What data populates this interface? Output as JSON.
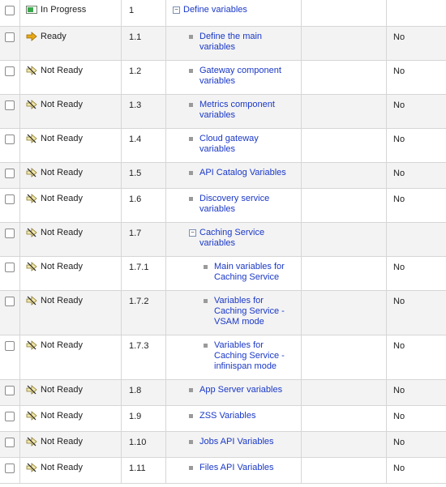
{
  "colors": {
    "link": "#1a38c7",
    "ready_arrow": "#e6a817",
    "progress_green": "#3aa84a",
    "grid": "#d6d6d6"
  },
  "rows": [
    {
      "state": "In Progress",
      "icon": "in-progress-icon",
      "number": "1",
      "title": "Define variables",
      "level": 0,
      "toggle": "−",
      "extra": "",
      "height": 32
    },
    {
      "state": "Ready",
      "icon": "ready-arrow-icon",
      "number": "1.1",
      "title": "Define the main variables",
      "level": 1,
      "extra": "No",
      "height": 42
    },
    {
      "state": "Not Ready",
      "icon": "not-ready-icon",
      "number": "1.2",
      "title": "Gateway component variables",
      "level": 1,
      "extra": "No",
      "height": 42
    },
    {
      "state": "Not Ready",
      "icon": "not-ready-icon",
      "number": "1.3",
      "title": "Metrics component variables",
      "level": 1,
      "extra": "No",
      "height": 42
    },
    {
      "state": "Not Ready",
      "icon": "not-ready-icon",
      "number": "1.4",
      "title": "Cloud gateway variables",
      "level": 1,
      "extra": "No",
      "height": 42
    },
    {
      "state": "Not Ready",
      "icon": "not-ready-icon",
      "number": "1.5",
      "title": "API Catalog Variables",
      "level": 1,
      "extra": "No",
      "height": 32
    },
    {
      "state": "Not Ready",
      "icon": "not-ready-icon",
      "number": "1.6",
      "title": "Discovery service variables",
      "level": 1,
      "extra": "No",
      "height": 42
    },
    {
      "state": "Not Ready",
      "icon": "not-ready-icon",
      "number": "1.7",
      "title": "Caching Service variables",
      "level": 1,
      "toggle": "−",
      "extra": "",
      "height": 42
    },
    {
      "state": "Not Ready",
      "icon": "not-ready-icon",
      "number": "1.7.1",
      "title": "Main variables for Caching Service",
      "level": 2,
      "extra": "No",
      "height": 42
    },
    {
      "state": "Not Ready",
      "icon": "not-ready-icon",
      "number": "1.7.2",
      "title": "Variables for Caching Service - VSAM mode",
      "level": 2,
      "extra": "No",
      "height": 55
    },
    {
      "state": "Not Ready",
      "icon": "not-ready-icon",
      "number": "1.7.3",
      "title": "Variables for Caching Service - infinispan mode",
      "level": 2,
      "extra": "No",
      "height": 55
    },
    {
      "state": "Not Ready",
      "icon": "not-ready-icon",
      "number": "1.8",
      "title": "App Server variables",
      "level": 1,
      "extra": "No",
      "height": 32
    },
    {
      "state": "Not Ready",
      "icon": "not-ready-icon",
      "number": "1.9",
      "title": "ZSS Variables",
      "level": 1,
      "extra": "No",
      "height": 32
    },
    {
      "state": "Not Ready",
      "icon": "not-ready-icon",
      "number": "1.10",
      "title": "Jobs API Variables",
      "level": 1,
      "extra": "No",
      "height": 32
    },
    {
      "state": "Not Ready",
      "icon": "not-ready-icon",
      "number": "1.11",
      "title": "Files API Variables",
      "level": 1,
      "extra": "No",
      "height": 32
    }
  ]
}
